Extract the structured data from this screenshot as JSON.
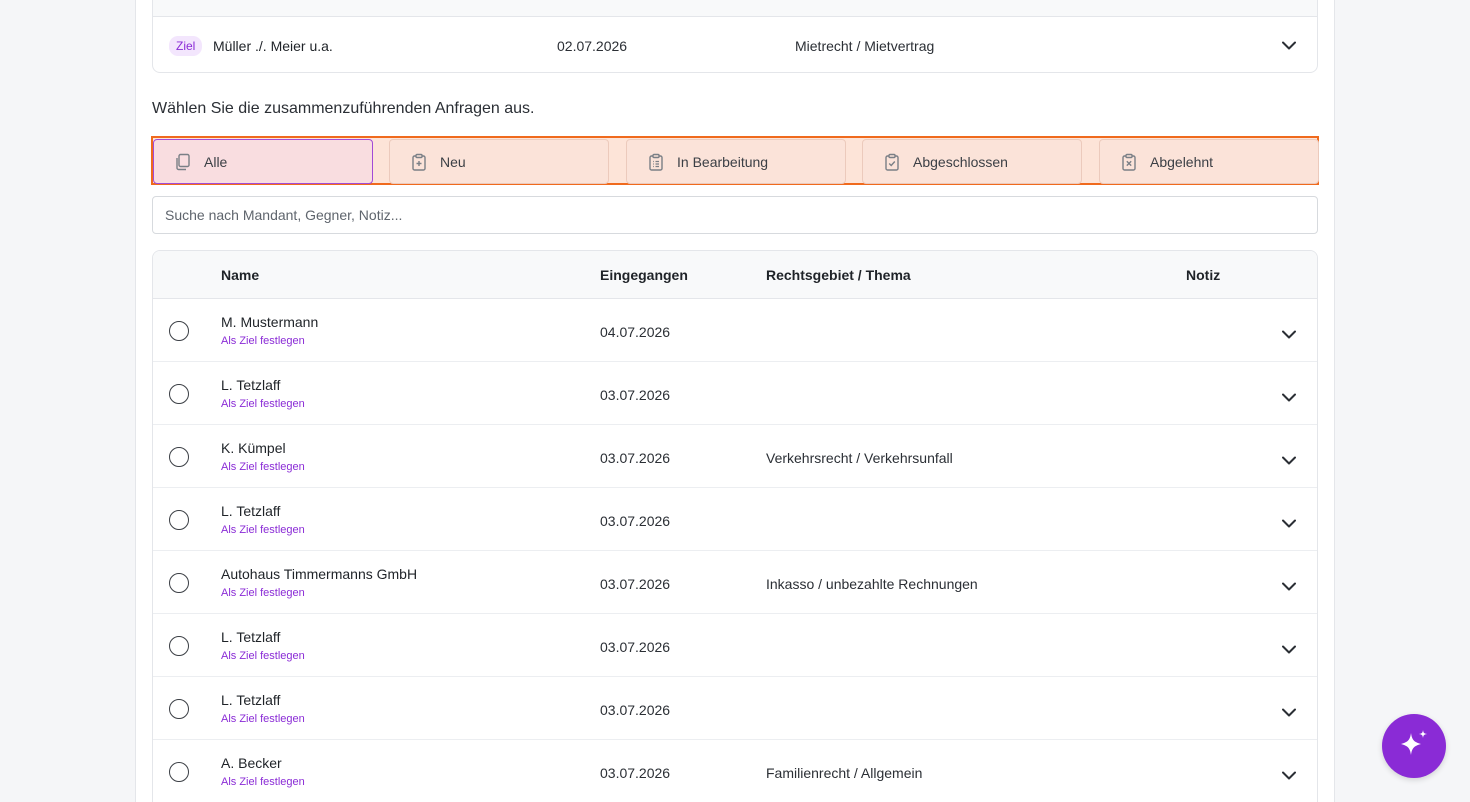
{
  "target": {
    "badge": "Ziel",
    "name": "Müller ./. Meier u.a.",
    "date": "02.07.2026",
    "area": "Mietrecht / Mietvertrag"
  },
  "instruction": "Wählen Sie die zusammenzuführenden Anfragen aus.",
  "filters": [
    {
      "label": "Alle",
      "icon": "copy-icon",
      "active": true
    },
    {
      "label": "Neu",
      "icon": "clipboard-plus-icon",
      "active": false
    },
    {
      "label": "In Bearbeitung",
      "icon": "clipboard-list-icon",
      "active": false
    },
    {
      "label": "Abgeschlossen",
      "icon": "clipboard-check-icon",
      "active": false
    },
    {
      "label": "Abgelehnt",
      "icon": "clipboard-x-icon",
      "active": false
    }
  ],
  "search": {
    "placeholder": "Suche nach Mandant, Gegner, Notiz..."
  },
  "table": {
    "headers": {
      "name": "Name",
      "received": "Eingegangen",
      "area": "Rechtsgebiet / Thema",
      "note": "Notiz"
    },
    "rows": [
      {
        "name": "M. Mustermann",
        "link": "Als Ziel festlegen",
        "date": "04.07.2026",
        "area": ""
      },
      {
        "name": "L. Tetzlaff",
        "link": "Als Ziel festlegen",
        "date": "03.07.2026",
        "area": ""
      },
      {
        "name": "K. Kümpel",
        "link": "Als Ziel festlegen",
        "date": "03.07.2026",
        "area": "Verkehrsrecht / Verkehrsunfall"
      },
      {
        "name": "L. Tetzlaff",
        "link": "Als Ziel festlegen",
        "date": "03.07.2026",
        "area": ""
      },
      {
        "name": "Autohaus Timmermanns GmbH",
        "link": "Als Ziel festlegen",
        "date": "03.07.2026",
        "area": "Inkasso / unbezahlte Rechnungen"
      },
      {
        "name": "L. Tetzlaff",
        "link": "Als Ziel festlegen",
        "date": "03.07.2026",
        "area": ""
      },
      {
        "name": "L. Tetzlaff",
        "link": "Als Ziel festlegen",
        "date": "03.07.2026",
        "area": ""
      },
      {
        "name": "A. Becker",
        "link": "Als Ziel festlegen",
        "date": "03.07.2026",
        "area": "Familienrecht / Allgemein"
      }
    ]
  },
  "fab": {
    "icon": "sparkles-icon"
  },
  "colors": {
    "accent": "#8a2bd6",
    "highlight_border": "#f06a1d",
    "highlight_fill": "#fde4d8"
  }
}
